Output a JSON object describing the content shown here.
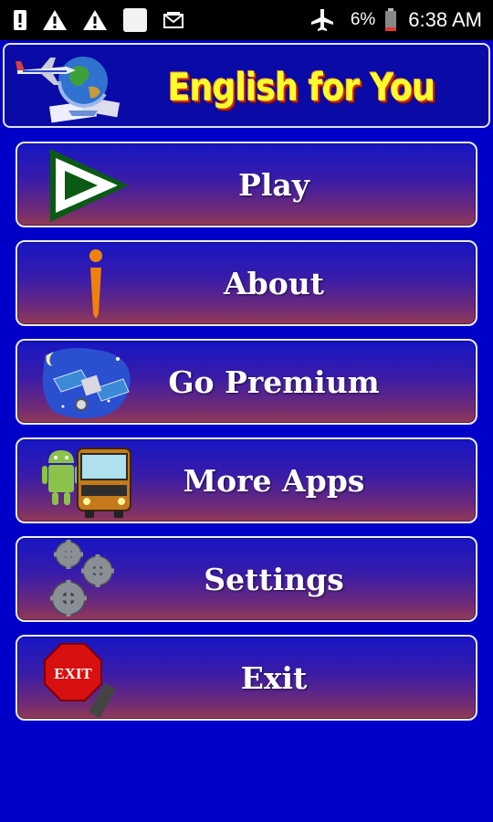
{
  "status_bar": {
    "battery_percent": "6%",
    "time": "6:38 AM",
    "icons": [
      "alert-icon",
      "warning-icon",
      "warning-icon",
      "blank-notification-icon",
      "mail-icon",
      "airplane-mode-icon",
      "battery-low-icon"
    ]
  },
  "header": {
    "title": "English for You",
    "logo": "airplane-globe-logo"
  },
  "menu": [
    {
      "label": "Play",
      "icon": "play-icon"
    },
    {
      "label": "About",
      "icon": "info-icon"
    },
    {
      "label": "Go Premium",
      "icon": "satellite-icon"
    },
    {
      "label": "More Apps",
      "icon": "android-bus-icon"
    },
    {
      "label": "Settings",
      "icon": "gears-icon"
    },
    {
      "label": "Exit",
      "icon": "exit-sign-icon"
    }
  ],
  "colors": {
    "background": "#0000c8",
    "title_yellow": "#f8ff2a",
    "button_top": "#1616c4",
    "button_bottom": "#923a55"
  }
}
